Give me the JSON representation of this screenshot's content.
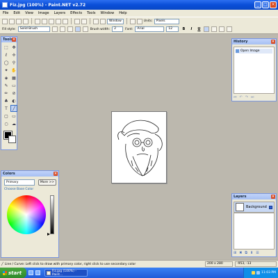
{
  "window": {
    "title": "Fiz.jpg (100%) - Paint.NET v2.72"
  },
  "menu": [
    "File",
    "Edit",
    "View",
    "Image",
    "Layers",
    "Effects",
    "Tools",
    "Window",
    "Help"
  ],
  "toolbar": {
    "zoom_select": "Window",
    "units_label": "Units:",
    "units_value": "Pixels",
    "fill_style_label": "Fill style:",
    "fill_style_value": "Solid Brush",
    "brush_width_label": "Brush width:",
    "brush_width_value": "2",
    "font_label": "Font:",
    "font_value": "Arial",
    "font_size_value": "12",
    "bold": "B",
    "italic": "I",
    "underline": "U"
  },
  "panels": {
    "tools": {
      "title": "Tools"
    },
    "history": {
      "title": "History",
      "items": [
        "Open Image"
      ]
    },
    "colors": {
      "title": "Colors",
      "mode": "Primary",
      "more_button": "More >>",
      "choose_label": "Choose Base Color"
    },
    "layers": {
      "title": "Layers",
      "items": [
        "Background"
      ]
    }
  },
  "status": {
    "message": "Line / Curve: Left click to draw with primary color, right click to use secondary color",
    "image_size": "200 x 280",
    "cursor": "-953, -13"
  },
  "taskbar": {
    "start_label": "start",
    "task_label": "Fiz.jpg (100%) - Paint...",
    "clock": "11:03 PM"
  },
  "colors": {
    "primary": "#000000",
    "secondary": "#ffffff",
    "workspace": "#bcb8ae"
  }
}
